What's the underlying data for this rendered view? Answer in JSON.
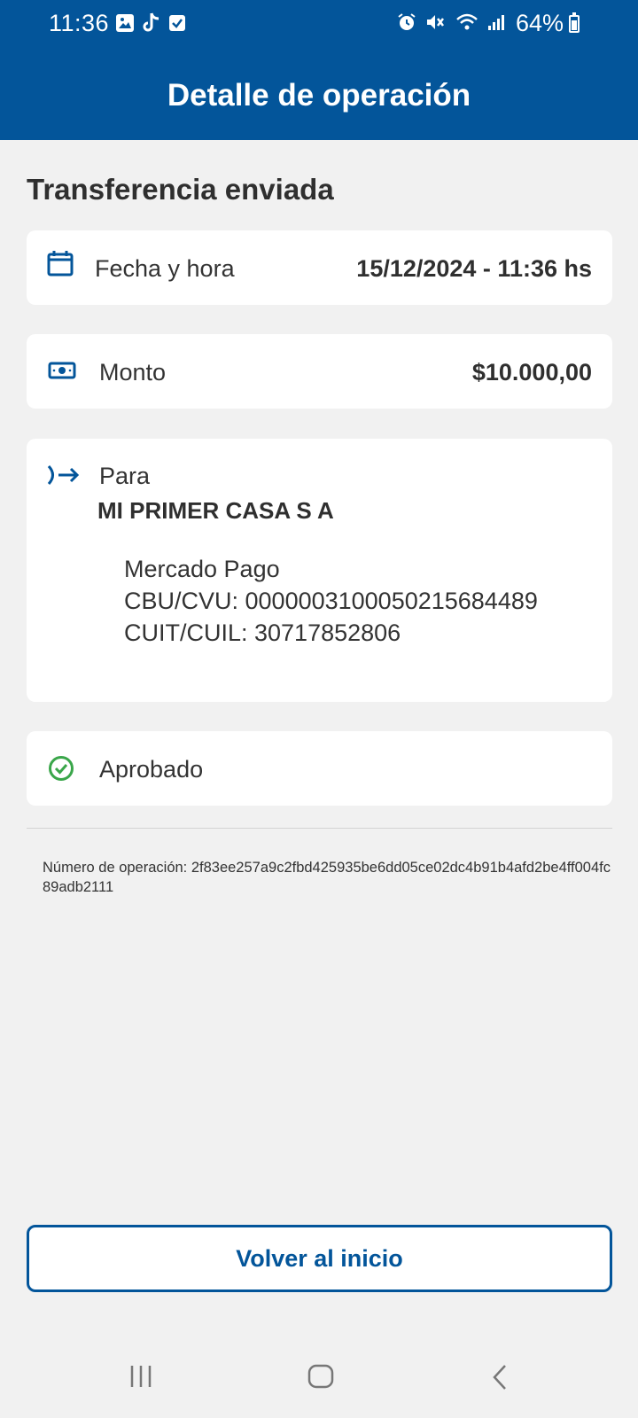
{
  "status_bar": {
    "time": "11:36",
    "battery": "64%",
    "left_icons": [
      "gallery-icon",
      "tiktok-icon",
      "check-square-icon"
    ],
    "right_icons": [
      "alarm-icon",
      "mute-icon",
      "wifi-icon",
      "signal-icon",
      "battery-icon"
    ]
  },
  "header": {
    "title": "Detalle de operación"
  },
  "section": {
    "title": "Transferencia enviada"
  },
  "fecha": {
    "label": "Fecha y hora",
    "value": "15/12/2024 - 11:36 hs",
    "icon": "calendar-icon"
  },
  "monto": {
    "label": "Monto",
    "value": "$10.000,00",
    "icon": "money-icon"
  },
  "para": {
    "label": "Para",
    "name": "MI PRIMER CASA S A",
    "bank": "Mercado Pago",
    "cbu": "CBU/CVU: 0000003100050215684489",
    "cuit": "CUIT/CUIL: 30717852806",
    "icon": "arrow-out-icon"
  },
  "estado": {
    "label": "Aprobado",
    "icon": "check-circle-icon",
    "color": "#3aa64a"
  },
  "operacion": {
    "text": "Número de operación: 2f83ee257a9c2fbd425935be6dd05ce02dc4b91b4afd2be4ff004fc89adb2111"
  },
  "actions": {
    "back_label": "Volver al inicio"
  },
  "colors": {
    "primary": "#03559a",
    "background": "#f1f1f1",
    "card": "#ffffff"
  }
}
